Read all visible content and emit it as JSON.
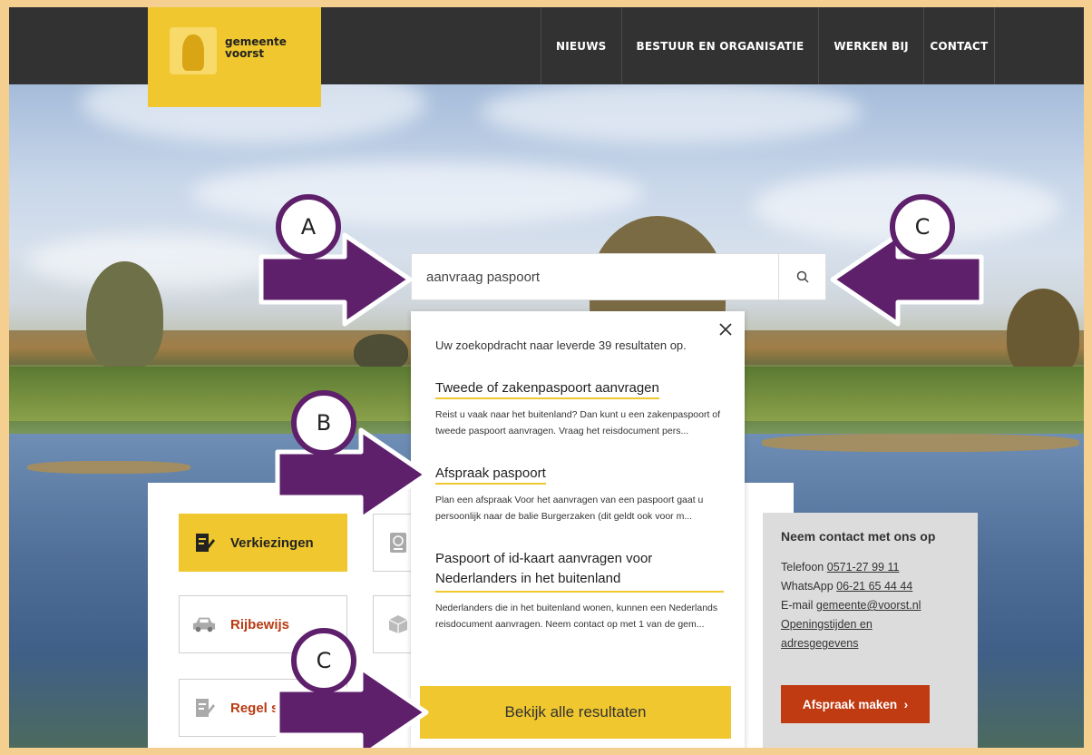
{
  "header": {
    "logo_text_line1": "gemeente",
    "logo_text_line2": "voorst",
    "nav": [
      "NIEUWS",
      "BESTUUR EN ORGANISATIE",
      "WERKEN BIJ",
      "CONTACT"
    ]
  },
  "search": {
    "value": "aanvraag paspoort"
  },
  "dropdown": {
    "count_text": "Uw zoekopdracht naar leverde 39 resultaten op.",
    "results": [
      {
        "title": "Tweede of zakenpaspoort aanvragen",
        "desc": "Reist u vaak naar het buitenland? Dan kunt u een zakenpaspoort of tweede paspoort aanvragen. Vraag het reisdocument pers..."
      },
      {
        "title": "Afspraak paspoort",
        "desc": "Plan een afspraak Voor het aanvragen van een paspoort gaat u persoonlijk naar de balie Burgerzaken (dit geldt ook voor m..."
      },
      {
        "title": "Paspoort of id-kaart aanvragen voor Nederlanders in het buitenland",
        "desc": "Nederlanders die in het buitenland wonen, kunnen een Nederlands reisdocument aanvragen. Neem contact op met 1 van de gem..."
      }
    ],
    "all_results_label": "Bekijk alle resultaten"
  },
  "tiles": [
    {
      "label": "Verkiezingen",
      "icon": "vote-icon"
    },
    {
      "label": "Rijbewijs",
      "icon": "car-icon"
    },
    {
      "label": "Regel s",
      "icon": "document-icon"
    }
  ],
  "contact": {
    "heading": "Neem contact met ons op",
    "phone_label": "Telefoon",
    "phone": "0571-27 99 11",
    "whatsapp_label": "WhatsApp",
    "whatsapp": "06-21 65 44 44",
    "email_label": "E-mail",
    "email": "gemeente@voorst.nl",
    "hours_link_1": "Openingstijden en",
    "hours_link_2": "adresgegevens",
    "button_label": "Afspraak maken",
    "button_chevron": "›"
  },
  "annotations": {
    "a": "A",
    "b": "B",
    "c_top": "C",
    "c_bottom": "C"
  },
  "colors": {
    "brand_yellow": "#f0c72e",
    "header_dark": "#323232",
    "accent_red": "#c03a12",
    "annotation_purple": "#5e1f6b",
    "frame_border": "#f4cf8f"
  }
}
